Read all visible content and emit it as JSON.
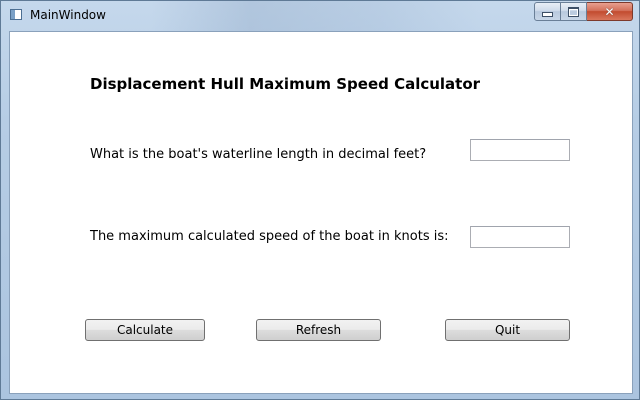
{
  "window": {
    "title": "MainWindow",
    "close_glyph": "✕"
  },
  "main": {
    "heading": "Displacement Hull Maximum Speed Calculator",
    "length_label": "What is the boat's waterline length in decimal feet?",
    "length_value": "",
    "speed_label": "The maximum calculated speed of the boat in knots is:",
    "speed_value": ""
  },
  "buttons": {
    "calculate": "Calculate",
    "refresh": "Refresh",
    "quit": "Quit"
  },
  "icons": {
    "app": "window-app-icon",
    "minimize": "minimize-icon",
    "maximize": "maximize-icon",
    "close": "close-icon"
  }
}
